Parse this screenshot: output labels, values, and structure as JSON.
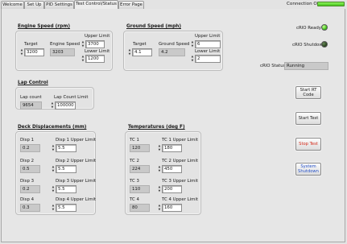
{
  "tabs": [
    "Welcome",
    "Set Up",
    "PID Settings",
    "Test Control/Status",
    "Error Page"
  ],
  "active_tab": "Test Control/Status",
  "connection": {
    "label": "Connection OK",
    "status_color": "#5ad02a"
  },
  "engine_speed": {
    "title": "Engine Speed (rpm)",
    "target_label": "Target",
    "target_value": "3200",
    "speed_label": "Engine Speed",
    "speed_value": "3203",
    "upper_label": "Upper Limit",
    "upper_value": "3700",
    "lower_label": "Lower Limit",
    "lower_value": "1200"
  },
  "ground_speed": {
    "title": "Ground Speed (mph)",
    "target_label": "Target",
    "target_value": "4.1",
    "speed_label": "Ground Speed",
    "speed_value": "4.2",
    "upper_label": "Upper Limit",
    "upper_value": "6",
    "lower_label": "Lower Limit",
    "lower_value": "2"
  },
  "crio": {
    "ready_label": "cRIO Ready",
    "shutdown_label": "cRIO Shutdown",
    "status_label": "cRIO Status",
    "status_value": "Running"
  },
  "lap_control": {
    "title": "Lap Control",
    "count_label": "Lap count",
    "count_value": "9654",
    "limit_label": "Lap Count Limit",
    "limit_value": "100000"
  },
  "deck": {
    "title": "Deck Displacements (mm)",
    "rows": [
      {
        "label": "Disp 1",
        "value": "0.2",
        "upper_label": "Disp 1 Upper Limit",
        "upper_value": "5.5"
      },
      {
        "label": "Disp 2",
        "value": "0.5",
        "upper_label": "Disp 2 Upper Limit",
        "upper_value": "5.5"
      },
      {
        "label": "Disp 3",
        "value": "0.2",
        "upper_label": "Disp 3 Upper Limit",
        "upper_value": "5.5"
      },
      {
        "label": "Disp 4",
        "value": "0.3",
        "upper_label": "Disp 4 Upper Limit",
        "upper_value": "5.5"
      }
    ]
  },
  "temps": {
    "title": "Temperatures (deg F)",
    "rows": [
      {
        "label": "TC 1",
        "value": "120",
        "upper_label": "TC 1 Upper Limit",
        "upper_value": "180"
      },
      {
        "label": "TC 2",
        "value": "224",
        "upper_label": "TC 2 Upper Limit",
        "upper_value": "450"
      },
      {
        "label": "TC 3",
        "value": "110",
        "upper_label": "TC 3 Upper Limit",
        "upper_value": "200"
      },
      {
        "label": "TC 4",
        "value": "80",
        "upper_label": "TC 4 Upper Limit",
        "upper_value": "160"
      }
    ]
  },
  "buttons": {
    "start_rt": "Start RT Code",
    "start_test": "Start Test",
    "stop_test": "Stop Test",
    "system_shutdown_1": "System",
    "system_shutdown_2": "Shutdown"
  },
  "colors": {
    "stop_text": "#d42a1a",
    "shutdown_text": "#2450c8",
    "led_on": "#42c51a",
    "led_off": "#2d4a22"
  },
  "icons": {
    "spinner": "increment-decrement-arrows-icon",
    "ready_led": "green-led-on-icon",
    "shutdown_led": "dark-led-off-icon"
  }
}
